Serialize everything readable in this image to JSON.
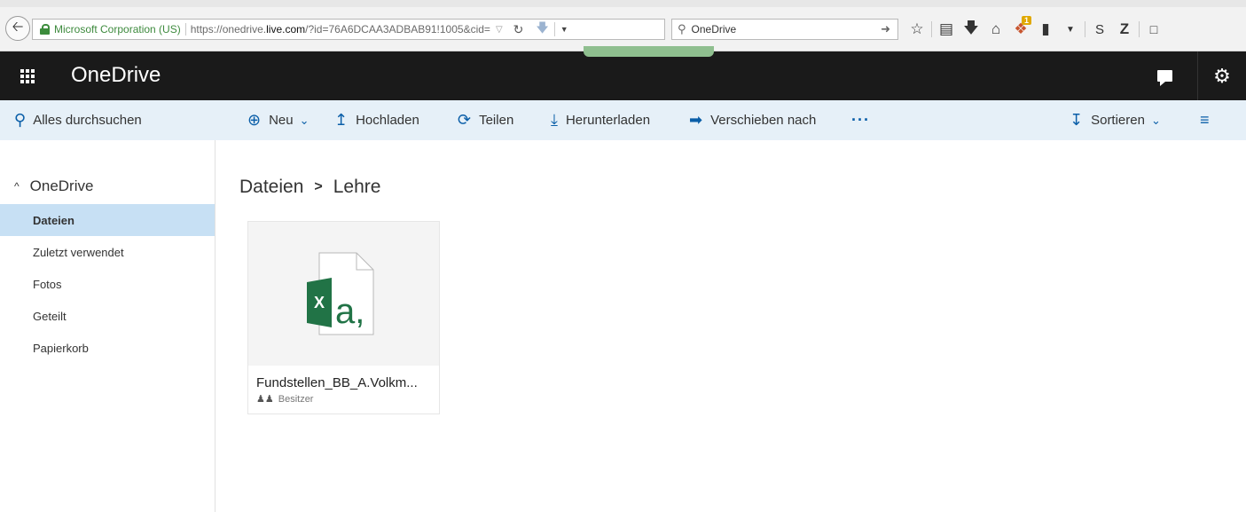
{
  "browser": {
    "site_identity": "Microsoft Corporation (US)",
    "url_prefix": "https://onedrive.",
    "url_domain": "live.com",
    "url_rest": "/?id=76A6DCAA3ADBAB91!1005&cid=",
    "search_value": "OneDrive",
    "extension_badge": "1"
  },
  "suite": {
    "app_title": "OneDrive"
  },
  "command_bar": {
    "search_label": "Alles durchsuchen",
    "new_label": "Neu",
    "upload_label": "Hochladen",
    "share_label": "Teilen",
    "download_label": "Herunterladen",
    "move_label": "Verschieben nach",
    "more_label": "···",
    "sort_label": "Sortieren"
  },
  "nav": {
    "root_label": "OneDrive",
    "items": [
      {
        "label": "Dateien",
        "active": true
      },
      {
        "label": "Zuletzt verwendet",
        "active": false
      },
      {
        "label": "Fotos",
        "active": false
      },
      {
        "label": "Geteilt",
        "active": false
      },
      {
        "label": "Papierkorb",
        "active": false
      }
    ]
  },
  "breadcrumb": {
    "root": "Dateien",
    "current": "Lehre"
  },
  "files": [
    {
      "name": "Fundstellen_BB_A.Volkm...",
      "owner_label": "Besitzer",
      "icon_letter": "X",
      "icon_glyph": "a,",
      "accent_color": "#217346"
    }
  ],
  "colors": {
    "suite_bar": "#1a1a1a",
    "command_bar": "#e6f0f8",
    "nav_active": "#c7e0f4",
    "accent_blue": "#0a5ea8"
  }
}
